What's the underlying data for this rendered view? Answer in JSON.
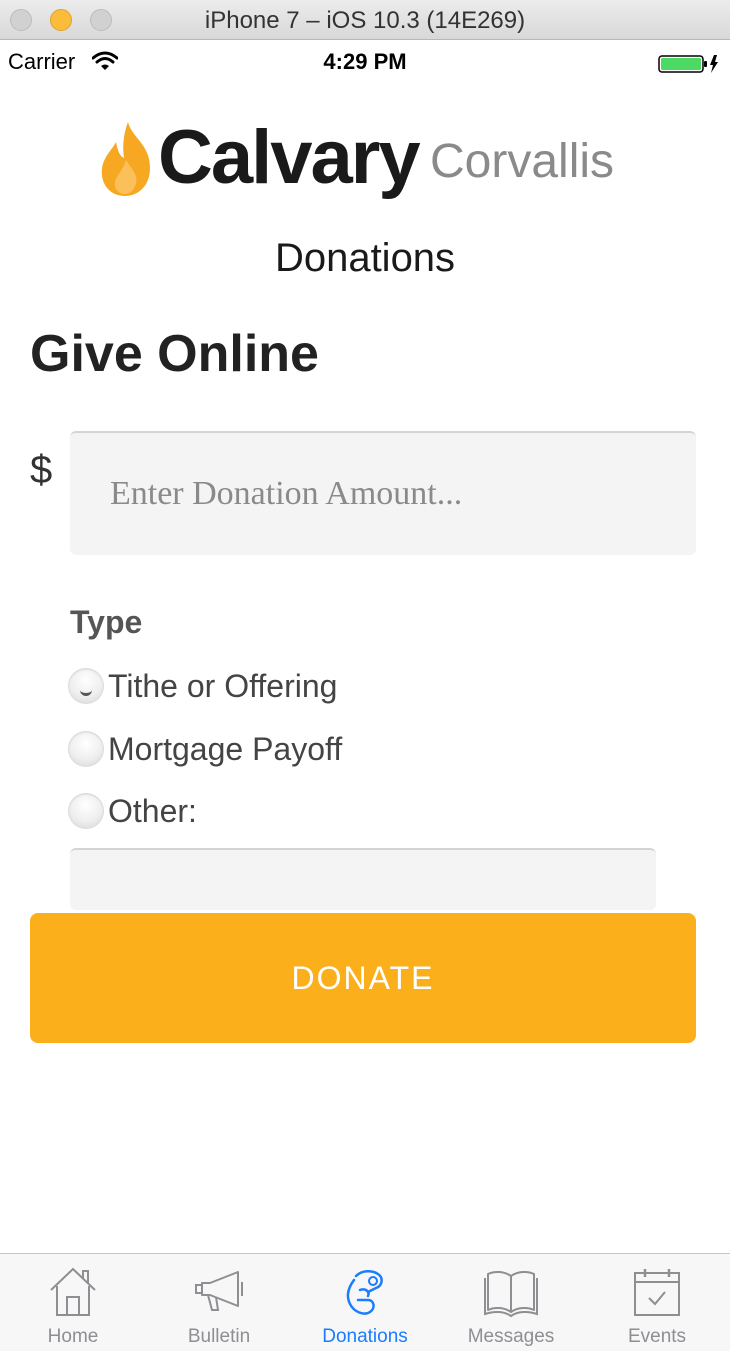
{
  "window": {
    "title": "iPhone 7 – iOS 10.3 (14E269)"
  },
  "status_bar": {
    "carrier": "Carrier",
    "time": "4:29 PM"
  },
  "logo": {
    "main": "Calvary",
    "sub": "Corvallis"
  },
  "page": {
    "title": "Donations",
    "heading": "Give Online"
  },
  "form": {
    "currency_symbol": "$",
    "amount_placeholder": "Enter Donation Amount...",
    "type_label": "Type",
    "types": [
      {
        "label": "Tithe or Offering",
        "selected": true
      },
      {
        "label": "Mortgage Payoff",
        "selected": false
      },
      {
        "label": "Other:",
        "selected": false
      }
    ],
    "other_value": "",
    "submit_label": "DONATE"
  },
  "tabs": [
    {
      "label": "Home",
      "icon": "home-icon",
      "active": false
    },
    {
      "label": "Bulletin",
      "icon": "megaphone-icon",
      "active": false
    },
    {
      "label": "Donations",
      "icon": "donation-hand-icon",
      "active": true
    },
    {
      "label": "Messages",
      "icon": "book-icon",
      "active": false
    },
    {
      "label": "Events",
      "icon": "calendar-icon",
      "active": false
    }
  ],
  "colors": {
    "accent": "#fbaf1b",
    "tab_active": "#1a7cff",
    "tab_inactive": "#8e8e93",
    "logo_flame": "#f7a823"
  }
}
